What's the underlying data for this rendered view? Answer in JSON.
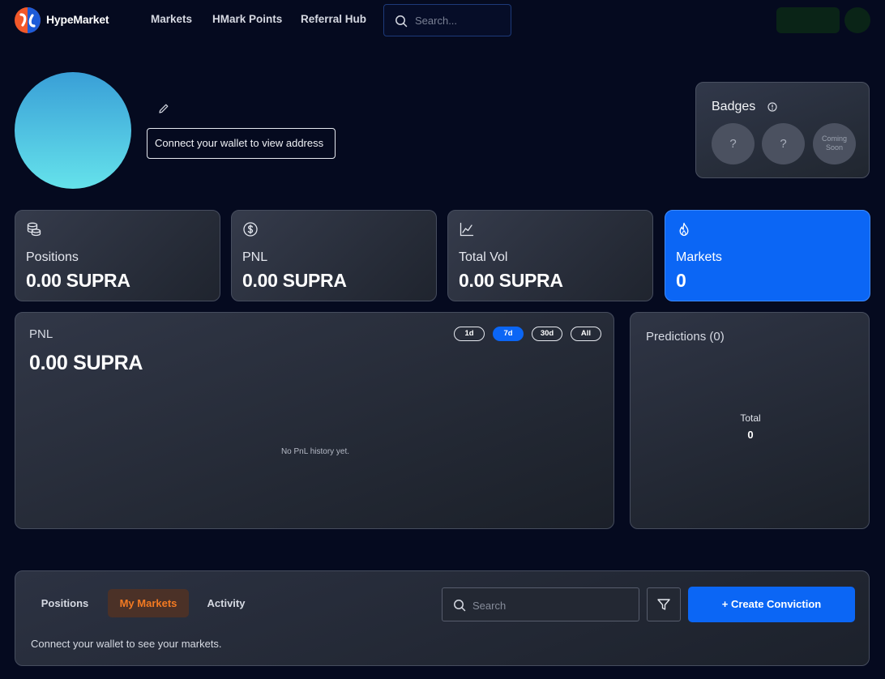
{
  "nav": {
    "brand": "HypeMarket",
    "links": [
      "Markets",
      "HMark Points",
      "Referral Hub"
    ],
    "search_placeholder": "Search..."
  },
  "profile": {
    "wallet_prompt": "Connect your wallet to view address"
  },
  "badges": {
    "title": "Badges",
    "items": [
      "?",
      "?"
    ],
    "coming_soon": "Coming Soon"
  },
  "stats": [
    {
      "label": "Positions",
      "value": "0.00 SUPRA",
      "icon": "coins-icon"
    },
    {
      "label": "PNL",
      "value": "0.00 SUPRA",
      "icon": "dollar-circle-icon"
    },
    {
      "label": "Total Vol",
      "value": "0.00 SUPRA",
      "icon": "line-chart-icon"
    },
    {
      "label": "Markets",
      "value": "0",
      "icon": "flame-icon"
    }
  ],
  "pnl": {
    "title": "PNL",
    "value": "0.00 SUPRA",
    "ranges": [
      "1d",
      "7d",
      "30d",
      "All"
    ],
    "selected_range": "7d",
    "empty": "No PnL history yet."
  },
  "predictions": {
    "title": "Predictions (0)",
    "total_label": "Total",
    "total_value": "0"
  },
  "bottom": {
    "tabs": [
      "Positions",
      "My Markets",
      "Activity"
    ],
    "active_tab": "My Markets",
    "search_placeholder": "Search",
    "create_label": "+ Create Conviction",
    "message": "Connect your wallet to see your markets."
  },
  "colors": {
    "background": "#050a1f",
    "accent_blue": "#0b66f5",
    "accent_orange": "#f47a22",
    "avatar_gradient": [
      "#399fd7",
      "#65e2eb"
    ]
  }
}
